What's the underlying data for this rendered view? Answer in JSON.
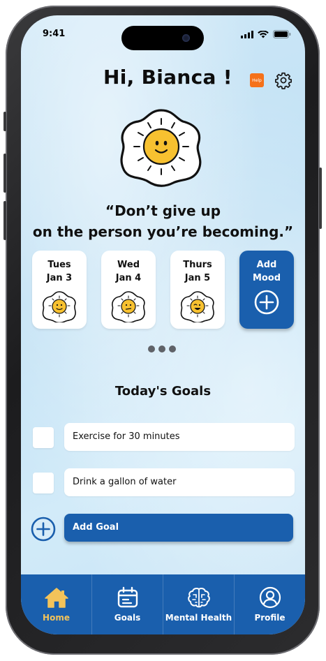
{
  "status_bar": {
    "time": "9:41"
  },
  "header": {
    "greeting": "Hi, Bianca !",
    "help_label": "Help"
  },
  "quote": {
    "line1": "“Don’t give up",
    "line2": "on the person you’re becoming.”"
  },
  "mood_cards": [
    {
      "day": "Tues",
      "date": "Jan 3",
      "mood": "happy"
    },
    {
      "day": "Wed",
      "date": "Jan 4",
      "mood": "neutral"
    },
    {
      "day": "Thurs",
      "date": "Jan 5",
      "mood": "winking"
    }
  ],
  "add_mood": {
    "line1": "Add",
    "line2": "Mood"
  },
  "goals": {
    "title": "Today's Goals",
    "items": [
      {
        "text": "Exercise for 30 minutes",
        "checked": false
      },
      {
        "text": "Drink a gallon of water",
        "checked": false
      }
    ],
    "add_label": "Add Goal"
  },
  "tabbar": [
    {
      "label": "Home",
      "icon": "home-icon",
      "active": true
    },
    {
      "label": "Goals",
      "icon": "calendar-icon",
      "active": false
    },
    {
      "label": "Mental Health",
      "icon": "brain-icon",
      "active": false
    },
    {
      "label": "Profile",
      "icon": "profile-icon",
      "active": false
    }
  ],
  "colors": {
    "primary": "#1a5fad",
    "active_tab": "#f3c35a",
    "help_badge": "#f5711a",
    "egg_yolk": "#f7c130"
  }
}
